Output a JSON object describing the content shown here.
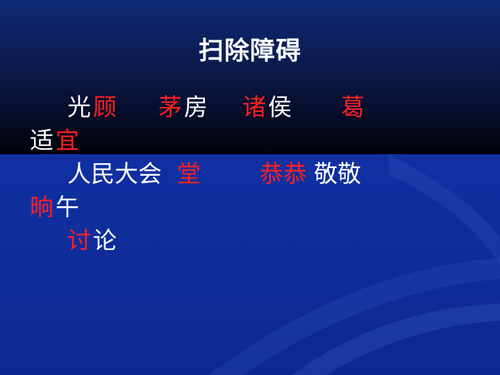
{
  "slide": {
    "title": "扫除障碍",
    "line1": [
      {
        "text": "光",
        "style": "normal"
      },
      {
        "text": "顾",
        "style": "red"
      },
      {
        "text": "茅",
        "style": "red"
      },
      {
        "text": "房",
        "style": "normal"
      },
      {
        "text": "诸",
        "style": "red"
      },
      {
        "text": "侯",
        "style": "normal"
      },
      {
        "text": "葛",
        "style": "red"
      }
    ],
    "line2": [
      {
        "text": "适",
        "style": "normal"
      },
      {
        "text": "宜",
        "style": "red"
      }
    ],
    "line3": [
      {
        "text": "人民大会",
        "style": "normal"
      },
      {
        "text": "堂",
        "style": "red"
      },
      {
        "text": "恭恭",
        "style": "red"
      },
      {
        "text": "敬敬",
        "style": "normal"
      }
    ],
    "line4": [
      {
        "text": "晌",
        "style": "red"
      },
      {
        "text": "午",
        "style": "normal"
      }
    ],
    "line5": [
      {
        "text": "讨",
        "style": "red"
      },
      {
        "text": "论",
        "style": "normal"
      }
    ]
  },
  "colors": {
    "red": "#ff2020",
    "text": "#ffffff",
    "background": "#0c2a96"
  }
}
